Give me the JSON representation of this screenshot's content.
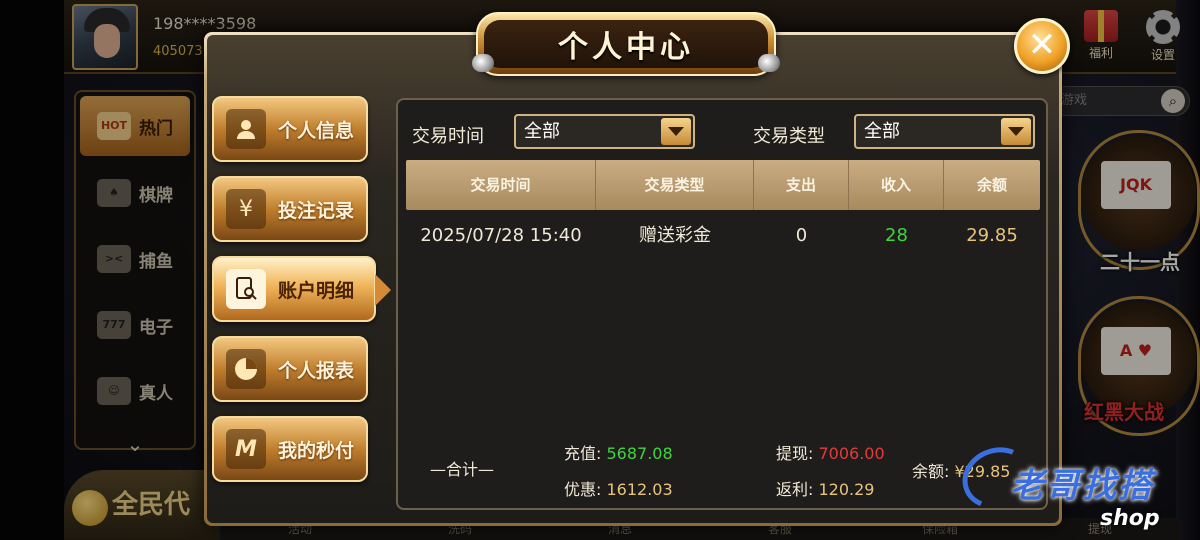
{
  "lobby": {
    "user_name": "198****3598",
    "user_id": "405073",
    "top_right": [
      {
        "label": "福利",
        "icon": "gift-icon"
      },
      {
        "label": "设置",
        "icon": "gear-icon"
      }
    ],
    "search_placeholder": "游戏",
    "side_nav": [
      {
        "label": "热门",
        "icon": "hot-icon",
        "icon_text": "HOT",
        "active": true
      },
      {
        "label": "棋牌",
        "icon": "cards-icon"
      },
      {
        "label": "捕鱼",
        "icon": "fish-icon"
      },
      {
        "label": "电子",
        "icon": "slot-icon"
      },
      {
        "label": "真人",
        "icon": "dealer-icon"
      }
    ],
    "promo_label": "全民代",
    "bottom_nav": [
      "活动",
      "洗码",
      "消息",
      "客服",
      "保险箱",
      "提现"
    ],
    "games": [
      {
        "label": "二十一点",
        "icon": "blackjack-icon",
        "card_text": "JQK"
      },
      {
        "label": "红黑大战",
        "icon": "red-black-icon",
        "card_text": "A ♥"
      }
    ]
  },
  "modal": {
    "title": "个人中心",
    "close_icon": "close-icon",
    "menu": [
      {
        "label": "个人信息",
        "icon": "user-icon",
        "glyph": "👤",
        "active": false
      },
      {
        "label": "投注记录",
        "icon": "money-icon",
        "glyph": "¥",
        "active": false
      },
      {
        "label": "账户明细",
        "icon": "document-search-icon",
        "glyph": "🔍",
        "active": true
      },
      {
        "label": "个人报表",
        "icon": "pie-chart-icon",
        "glyph": "◔",
        "active": false
      },
      {
        "label": "我的秒付",
        "icon": "m-logo-icon",
        "glyph": "M",
        "active": false
      }
    ],
    "filters": {
      "time_label": "交易时间",
      "time_value": "全部",
      "type_label": "交易类型",
      "type_value": "全部"
    },
    "table": {
      "headers": [
        "交易时间",
        "交易类型",
        "支出",
        "收入",
        "余额"
      ],
      "rows": [
        [
          "2025/07/28 15:40",
          "赠送彩金",
          "0",
          "28",
          "29.85"
        ]
      ]
    },
    "summary": {
      "label": "—合计—",
      "recharge_label": "充值:",
      "recharge_value": "5687.08",
      "discount_label": "优惠:",
      "discount_value": "1612.03",
      "withdraw_label": "提现:",
      "withdraw_value": "7006.00",
      "rebate_label": "返利:",
      "rebate_value": "120.29",
      "balance_label": "余额:",
      "balance_value": "¥29.85"
    }
  },
  "watermark": {
    "text": "老哥找搭",
    "sub": "shop"
  },
  "colors": {
    "gold": "#c88a33",
    "income_green": "#3fd43f",
    "withdraw_red": "#e23b3b",
    "watermark_blue": "#3b6fe0"
  }
}
